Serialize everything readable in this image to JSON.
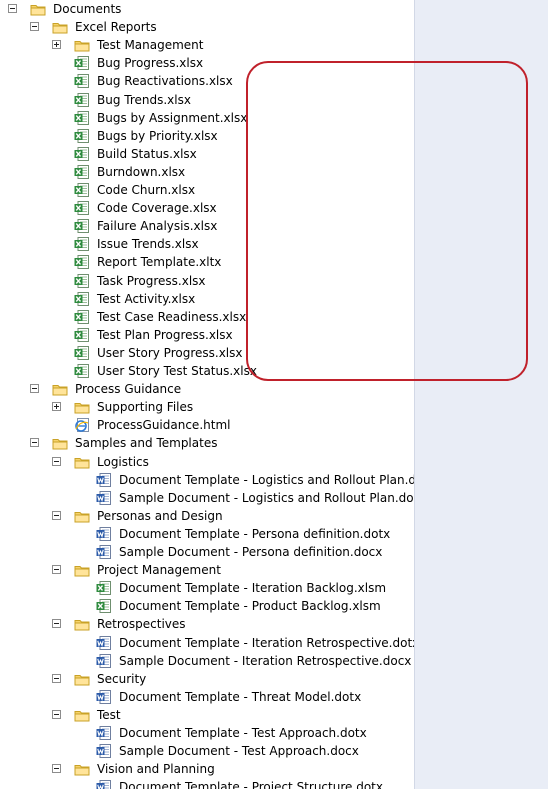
{
  "tree": [
    {
      "level": 0,
      "type": "folder",
      "expander": "collapse",
      "label": "Documents"
    },
    {
      "level": 1,
      "type": "folder",
      "expander": "collapse",
      "label": "Excel Reports"
    },
    {
      "level": 2,
      "type": "folder",
      "expander": "expand",
      "label": "Test Management"
    },
    {
      "level": 2,
      "type": "excel",
      "label": "Bug Progress.xlsx"
    },
    {
      "level": 2,
      "type": "excel",
      "label": "Bug Reactivations.xlsx"
    },
    {
      "level": 2,
      "type": "excel",
      "label": "Bug Trends.xlsx"
    },
    {
      "level": 2,
      "type": "excel",
      "label": "Bugs by Assignment.xlsx"
    },
    {
      "level": 2,
      "type": "excel",
      "label": "Bugs by Priority.xlsx"
    },
    {
      "level": 2,
      "type": "excel",
      "label": "Build Status.xlsx"
    },
    {
      "level": 2,
      "type": "excel",
      "label": "Burndown.xlsx"
    },
    {
      "level": 2,
      "type": "excel",
      "label": "Code Churn.xlsx"
    },
    {
      "level": 2,
      "type": "excel",
      "label": "Code Coverage.xlsx"
    },
    {
      "level": 2,
      "type": "excel",
      "label": "Failure Analysis.xlsx"
    },
    {
      "level": 2,
      "type": "excel",
      "label": "Issue Trends.xlsx"
    },
    {
      "level": 2,
      "type": "excel",
      "label": "Report Template.xltx"
    },
    {
      "level": 2,
      "type": "excel",
      "label": "Task Progress.xlsx"
    },
    {
      "level": 2,
      "type": "excel",
      "label": "Test Activity.xlsx"
    },
    {
      "level": 2,
      "type": "excel",
      "label": "Test Case Readiness.xlsx"
    },
    {
      "level": 2,
      "type": "excel",
      "label": "Test Plan Progress.xlsx"
    },
    {
      "level": 2,
      "type": "excel",
      "label": "User Story Progress.xlsx"
    },
    {
      "level": 2,
      "type": "excel",
      "label": "User Story Test Status.xlsx"
    },
    {
      "level": 1,
      "type": "folder",
      "expander": "collapse",
      "label": "Process Guidance"
    },
    {
      "level": 2,
      "type": "folder",
      "expander": "expand",
      "label": "Supporting Files"
    },
    {
      "level": 2,
      "type": "html",
      "label": "ProcessGuidance.html"
    },
    {
      "level": 1,
      "type": "folder",
      "expander": "collapse",
      "label": "Samples and Templates"
    },
    {
      "level": 2,
      "type": "folder",
      "expander": "collapse",
      "label": "Logistics"
    },
    {
      "level": 3,
      "type": "word",
      "label": "Document Template - Logistics and Rollout Plan.dotx"
    },
    {
      "level": 3,
      "type": "word",
      "label": "Sample Document - Logistics and Rollout Plan.docx"
    },
    {
      "level": 2,
      "type": "folder",
      "expander": "collapse",
      "label": "Personas and Design"
    },
    {
      "level": 3,
      "type": "word",
      "label": "Document Template - Persona definition.dotx"
    },
    {
      "level": 3,
      "type": "word",
      "label": "Sample Document - Persona definition.docx"
    },
    {
      "level": 2,
      "type": "folder",
      "expander": "collapse",
      "label": "Project Management"
    },
    {
      "level": 3,
      "type": "excel",
      "label": "Document Template - Iteration Backlog.xlsm"
    },
    {
      "level": 3,
      "type": "excel",
      "label": "Document Template - Product Backlog.xlsm"
    },
    {
      "level": 2,
      "type": "folder",
      "expander": "collapse",
      "label": "Retrospectives"
    },
    {
      "level": 3,
      "type": "word",
      "label": "Document Template - Iteration Retrospective.dotx"
    },
    {
      "level": 3,
      "type": "word",
      "label": "Sample Document - Iteration Retrospective.docx"
    },
    {
      "level": 2,
      "type": "folder",
      "expander": "collapse",
      "label": "Security"
    },
    {
      "level": 3,
      "type": "word",
      "label": "Document Template - Threat Model.dotx"
    },
    {
      "level": 2,
      "type": "folder",
      "expander": "collapse",
      "label": "Test"
    },
    {
      "level": 3,
      "type": "word",
      "label": "Document Template - Test Approach.dotx"
    },
    {
      "level": 3,
      "type": "word",
      "label": "Sample Document - Test Approach.docx"
    },
    {
      "level": 2,
      "type": "folder",
      "expander": "collapse",
      "label": "Vision and Planning"
    },
    {
      "level": 3,
      "type": "word",
      "label": "Document Template - Project Structure.dotx"
    }
  ],
  "colors": {
    "highlight": "#c0212b",
    "folder": "#f2c94c",
    "excel": "#2e8b3e",
    "word": "#2b5aa8",
    "html": "#2f7bd6"
  }
}
